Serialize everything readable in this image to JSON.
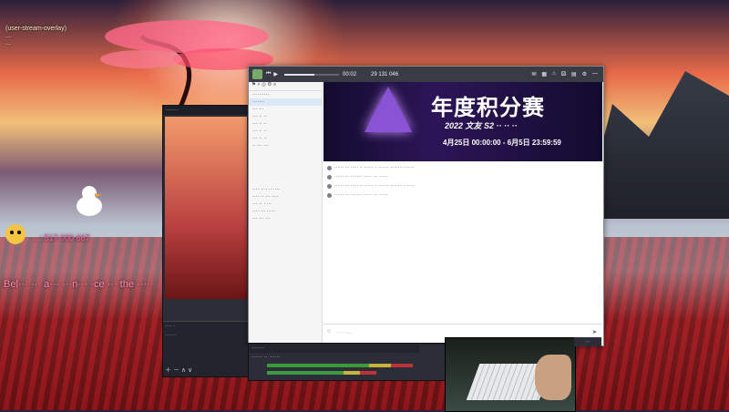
{
  "desktop": {
    "overlay_lines": [
      "(user-stream-overlay)",
      "...",
      "..."
    ],
    "phone_label": "...: 517 000 667",
    "wall_text": "Bel··· ··· a··· ···n··· ·ce ··· the ·····"
  },
  "qq": {
    "top": {
      "song_time": "00:02",
      "number": "29 131 046"
    },
    "sidebar": {
      "header": "··········",
      "selected_item": "·······",
      "items": [
        "··· ···",
        "··· ·· ··",
        "··· ·· ··",
        "··· ·· ··",
        "··· ·· ··",
        "·· ··· ···"
      ],
      "bottom_items": [
        "···· ···· ··· ···",
        "···· ·· ··· ····",
        "··· ·· · ···",
        "···· ··· ·····",
        "··· ··· ···"
      ]
    },
    "banner": {
      "title": "年度积分赛",
      "subtitle": "2022 文友 S2 ·· ·· ··",
      "date": "4月25日 00:00:00 - 6月5日 23:59:59"
    },
    "messages": [
      "······ ··· ····· ·· ······ ·· ······· ········ ·······",
      "······ ··· ······· ······ ··· ······",
      "······ ··· ····· ·· ······ ·· ······· ········ ·······",
      "······ ··· ······· ······ ··· ······"
    ],
    "input_placeholder": "······...",
    "send_icon": "send-icon"
  },
  "obs": {
    "title": "·······",
    "panel_title": "···· ·",
    "scene_label": "······"
  },
  "dock": {
    "title": "·······",
    "row1": "······ ·· ······",
    "row2": "······ ·······"
  },
  "colors": {
    "banner_bg": "#1b1040",
    "accent": "#8a53d6"
  }
}
